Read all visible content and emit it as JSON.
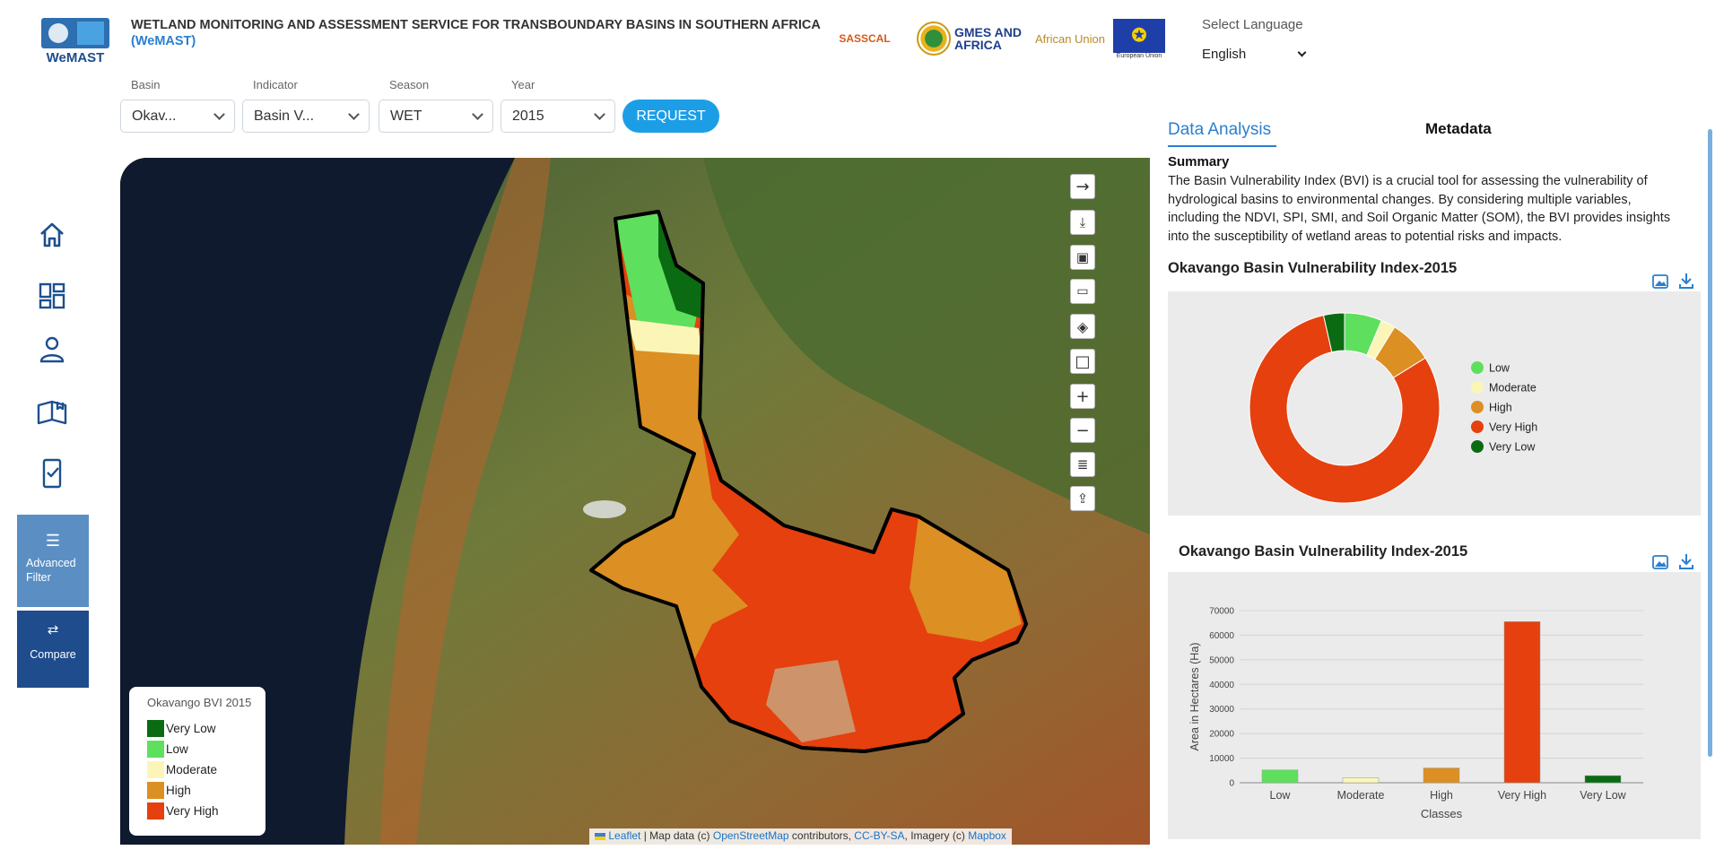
{
  "header": {
    "logo_text": "WeMAST",
    "title": "WETLAND MONITORING AND ASSESSMENT SERVICE FOR TRANSBOUNDARY BASINS IN SOUTHERN AFRICA",
    "subtitle": "(WeMAST)",
    "partners": [
      "SASSCAL",
      "GMES AND AFRICA",
      "African Union",
      "European Union"
    ],
    "language_label": "Select Language",
    "language_value": "English"
  },
  "filters": {
    "basin": {
      "label": "Basin",
      "value": "Okav..."
    },
    "indicator": {
      "label": "Indicator",
      "value": "Basin V..."
    },
    "season": {
      "label": "Season",
      "value": "WET"
    },
    "year": {
      "label": "Year",
      "value": "2015"
    },
    "request_label": "REQUEST"
  },
  "sidebar": {
    "items": [
      "home-icon",
      "dashboard-icon",
      "user-icon",
      "book-icon",
      "mobile-check-icon"
    ],
    "advanced_filter": "Advanced Filter",
    "compare": "Compare"
  },
  "map": {
    "legend_title": "Okavango BVI 2015",
    "legend": [
      {
        "label": "Very Low",
        "color": "#0b6b12"
      },
      {
        "label": "Low",
        "color": "#5ee05e"
      },
      {
        "label": "Moderate",
        "color": "#fbf6b8"
      },
      {
        "label": "High",
        "color": "#dc8f22"
      },
      {
        "label": "Very High",
        "color": "#e5400e"
      }
    ],
    "attribution": {
      "leaflet": "Leaflet",
      "text1": " | Map data (c) ",
      "osm": "OpenStreetMap",
      "text2": " contributors, ",
      "ccbysa": "CC-BY-SA",
      "text3": ", Imagery (c) ",
      "mapbox": "Mapbox"
    }
  },
  "panel": {
    "tab_analysis": "Data Analysis",
    "tab_metadata": "Metadata",
    "summary_heading": "Summary",
    "summary_text": "The Basin Vulnerability Index (BVI) is a crucial tool for assessing the vulnerability of hydrological basins to environmental changes. By considering multiple variables, including the NDVI, SPI, SMI, and Soil Organic Matter (SOM), the BVI provides insights into the susceptibility of wetland areas to potential risks and impacts.",
    "chart1_title": "Okavango Basin Vulnerability Index-2015",
    "chart2_title": "Okavango Basin Vulnerability Index-2015"
  },
  "chart_data": [
    {
      "type": "pie",
      "title": "Okavango Basin Vulnerability Index-2015",
      "legend_position": "right",
      "slices": [
        {
          "label": "Low",
          "value": 5200,
          "color": "#5ee05e"
        },
        {
          "label": "Moderate",
          "value": 2000,
          "color": "#fbf6b8"
        },
        {
          "label": "High",
          "value": 6000,
          "color": "#dc8f22"
        },
        {
          "label": "Very High",
          "value": 65500,
          "color": "#e5400e"
        },
        {
          "label": "Very Low",
          "value": 2900,
          "color": "#0b6b12"
        }
      ]
    },
    {
      "type": "bar",
      "title": "Okavango Basin Vulnerability Index-2015",
      "categories": [
        "Low",
        "Moderate",
        "High",
        "Very High",
        "Very Low"
      ],
      "values": [
        5200,
        2000,
        6000,
        65500,
        2900
      ],
      "colors": [
        "#5ee05e",
        "#fbf6b8",
        "#dc8f22",
        "#e5400e",
        "#0b6b12"
      ],
      "xlabel": "Classes",
      "ylabel": "Area in Hectares (Ha)",
      "ylim": [
        0,
        70000
      ],
      "yticks": [
        0,
        10000,
        20000,
        30000,
        40000,
        50000,
        60000,
        70000
      ],
      "grid": true
    }
  ]
}
